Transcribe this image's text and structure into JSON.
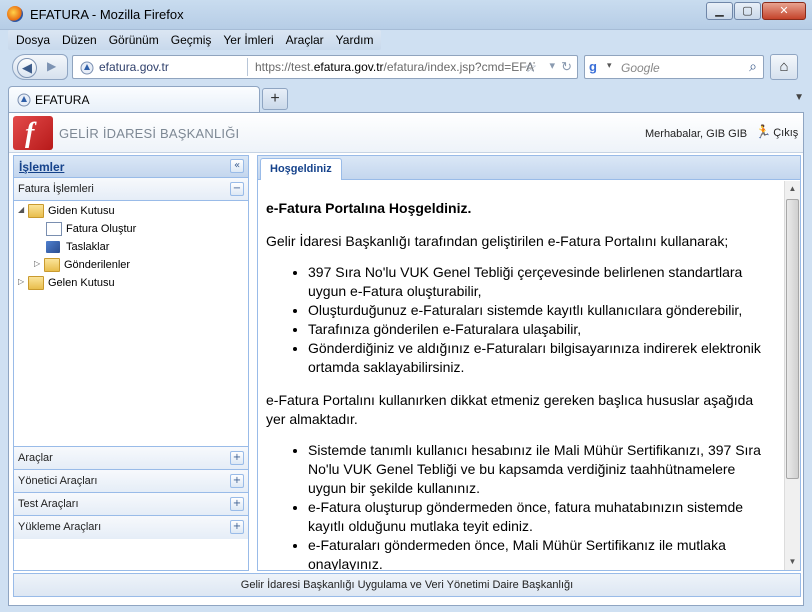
{
  "window": {
    "title": "EFATURA - Mozilla Firefox",
    "min_glyph": "▁",
    "max_glyph": "▢",
    "close_glyph": "✕"
  },
  "menu": [
    "Dosya",
    "Düzen",
    "Görünüm",
    "Geçmiş",
    "Yer İmleri",
    "Araçlar",
    "Yardım"
  ],
  "nav": {
    "site_host": "efatura.gov.tr",
    "url_prefix": "https://test.",
    "url_domain": "efatura.gov.tr",
    "url_rest": "/efatura/index.jsp?cmd=EFATURA_WE",
    "search_placeholder": "Google"
  },
  "tabs": {
    "active_label": "EFATURA",
    "new_tab_glyph": "+"
  },
  "app": {
    "brand": "GELİR İDARESİ BAŞKANLIĞI",
    "greeting": "Merhabalar, GIB GIB",
    "exit_label": "Çıkış"
  },
  "left_panel": {
    "title": "İşlemler",
    "collapse_glyph": "«",
    "section_open": "Fatura İşlemleri",
    "section_open_toggle": "−",
    "tree": {
      "outbox": "Giden Kutusu",
      "create_invoice": "Fatura Oluştur",
      "drafts": "Taslaklar",
      "sent": "Gönderilenler",
      "inbox": "Gelen Kutusu"
    },
    "sections": [
      "Araçlar",
      "Yönetici Araçları",
      "Test Araçları",
      "Yükleme Araçları"
    ],
    "expand_glyph": "+"
  },
  "content": {
    "tab": "Hoşgeldiniz",
    "heading": "e-Fatura Portalına Hoşgeldiniz.",
    "intro": "Gelir İdaresi Başkanlığı tarafından geliştirilen e-Fatura Portalını kullanarak;",
    "bullets1": [
      "397 Sıra No'lu VUK Genel Tebliği çerçevesinde belirlenen standartlara uygun e-Fatura oluşturabilir,",
      "Oluşturduğunuz e-Faturaları sistemde kayıtlı kullanıcılara gönderebilir,",
      "Tarafınıza gönderilen e-Faturalara ulaşabilir,",
      "Gönderdiğiniz ve aldığınız e-Faturaları bilgisayarınıza indirerek elektronik ortamda saklayabilirsiniz."
    ],
    "notice": "e-Fatura Portalını kullanırken dikkat etmeniz gereken başlıca hususlar aşağıda yer almaktadır.",
    "bullets2": [
      "Sistemde tanımlı kullanıcı hesabınız ile Mali Mühür Sertifikanızı, 397 Sıra No'lu VUK Genel Tebliği ve bu kapsamda verdiğiniz taahhütnamelere uygun bir şekilde kullanınız.",
      "e-Fatura oluşturup göndermeden önce, fatura muhatabınızın sistemde kayıtlı olduğunu mutlaka teyit ediniz.",
      "e-Faturaları göndermeden önce, Mali Mühür Sertifikanız ile mutlaka onaylayınız."
    ]
  },
  "footer": "Gelir İdaresi Başkanlığı Uygulama ve Veri Yönetimi Daire Başkanlığı"
}
